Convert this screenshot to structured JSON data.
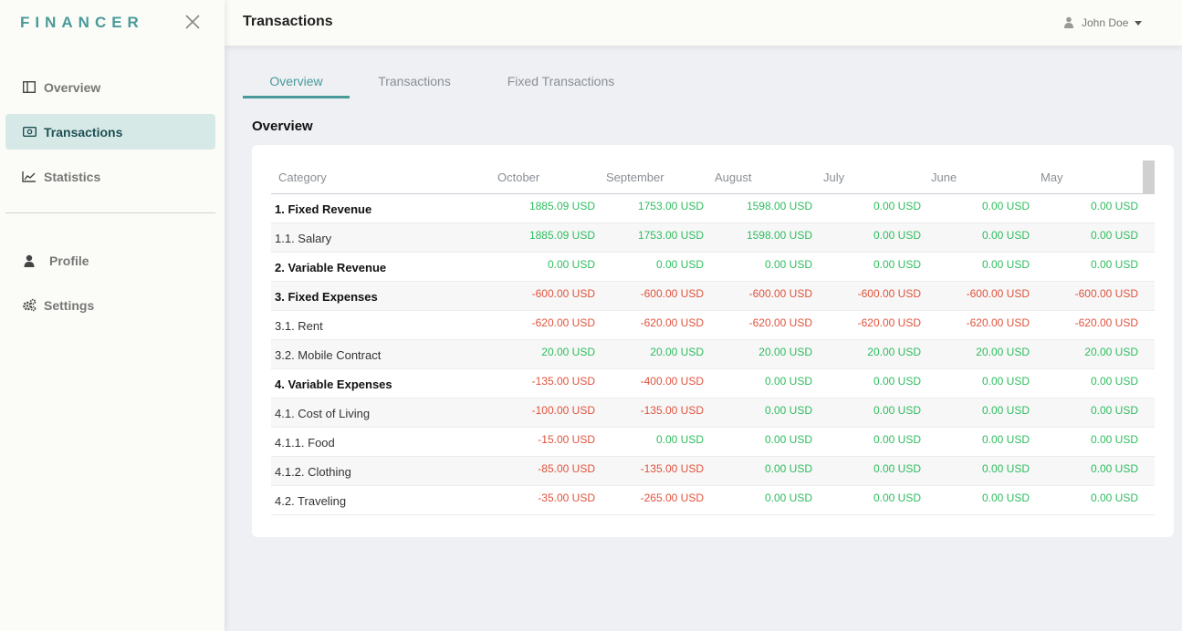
{
  "app": {
    "logo": "FINANCER",
    "page_title": "Transactions",
    "user_name": "John Doe"
  },
  "sidebar": {
    "items": [
      {
        "label": "Overview",
        "icon": "columns-icon",
        "active": false
      },
      {
        "label": "Transactions",
        "icon": "money-bill-icon",
        "active": true
      },
      {
        "label": "Statistics",
        "icon": "line-chart-icon",
        "active": false
      },
      {
        "label": "Profile",
        "icon": "user-icon",
        "active": false
      },
      {
        "label": "Settings",
        "icon": "gears-icon",
        "active": false
      }
    ]
  },
  "tabs": [
    {
      "label": "Overview",
      "active": true
    },
    {
      "label": "Transactions",
      "active": false
    },
    {
      "label": "Fixed Transactions",
      "active": false
    }
  ],
  "section_title": "Overview",
  "table": {
    "columns": [
      "Category",
      "October",
      "September",
      "August",
      "July",
      "June",
      "May"
    ],
    "rows": [
      {
        "category": "1. Fixed Revenue",
        "bold": true,
        "values": [
          "1885.09 USD",
          "1753.00 USD",
          "1598.00 USD",
          "0.00 USD",
          "0.00 USD",
          "0.00 USD"
        ]
      },
      {
        "category": "1.1. Salary",
        "bold": false,
        "values": [
          "1885.09 USD",
          "1753.00 USD",
          "1598.00 USD",
          "0.00 USD",
          "0.00 USD",
          "0.00 USD"
        ]
      },
      {
        "category": "2. Variable Revenue",
        "bold": true,
        "values": [
          "0.00 USD",
          "0.00 USD",
          "0.00 USD",
          "0.00 USD",
          "0.00 USD",
          "0.00 USD"
        ]
      },
      {
        "category": "3. Fixed Expenses",
        "bold": true,
        "values": [
          "-600.00 USD",
          "-600.00 USD",
          "-600.00 USD",
          "-600.00 USD",
          "-600.00 USD",
          "-600.00 USD"
        ]
      },
      {
        "category": "3.1. Rent",
        "bold": false,
        "values": [
          "-620.00 USD",
          "-620.00 USD",
          "-620.00 USD",
          "-620.00 USD",
          "-620.00 USD",
          "-620.00 USD"
        ]
      },
      {
        "category": "3.2. Mobile Contract",
        "bold": false,
        "values": [
          "20.00 USD",
          "20.00 USD",
          "20.00 USD",
          "20.00 USD",
          "20.00 USD",
          "20.00 USD"
        ]
      },
      {
        "category": "4. Variable Expenses",
        "bold": true,
        "values": [
          "-135.00 USD",
          "-400.00 USD",
          "0.00 USD",
          "0.00 USD",
          "0.00 USD",
          "0.00 USD"
        ]
      },
      {
        "category": "4.1. Cost of Living",
        "bold": false,
        "values": [
          "-100.00 USD",
          "-135.00 USD",
          "0.00 USD",
          "0.00 USD",
          "0.00 USD",
          "0.00 USD"
        ]
      },
      {
        "category": "4.1.1. Food",
        "bold": false,
        "values": [
          "-15.00 USD",
          "0.00 USD",
          "0.00 USD",
          "0.00 USD",
          "0.00 USD",
          "0.00 USD"
        ]
      },
      {
        "category": "4.1.2. Clothing",
        "bold": false,
        "values": [
          "-85.00 USD",
          "-135.00 USD",
          "0.00 USD",
          "0.00 USD",
          "0.00 USD",
          "0.00 USD"
        ]
      },
      {
        "category": "4.2. Traveling",
        "bold": false,
        "values": [
          "-35.00 USD",
          "-265.00 USD",
          "0.00 USD",
          "0.00 USD",
          "0.00 USD",
          "0.00 USD"
        ]
      }
    ]
  },
  "colors": {
    "accent": "#4a9a9b",
    "positive": "#2ebd5f",
    "negative": "#e0533d",
    "active_nav_bg": "#d7e9e6"
  }
}
